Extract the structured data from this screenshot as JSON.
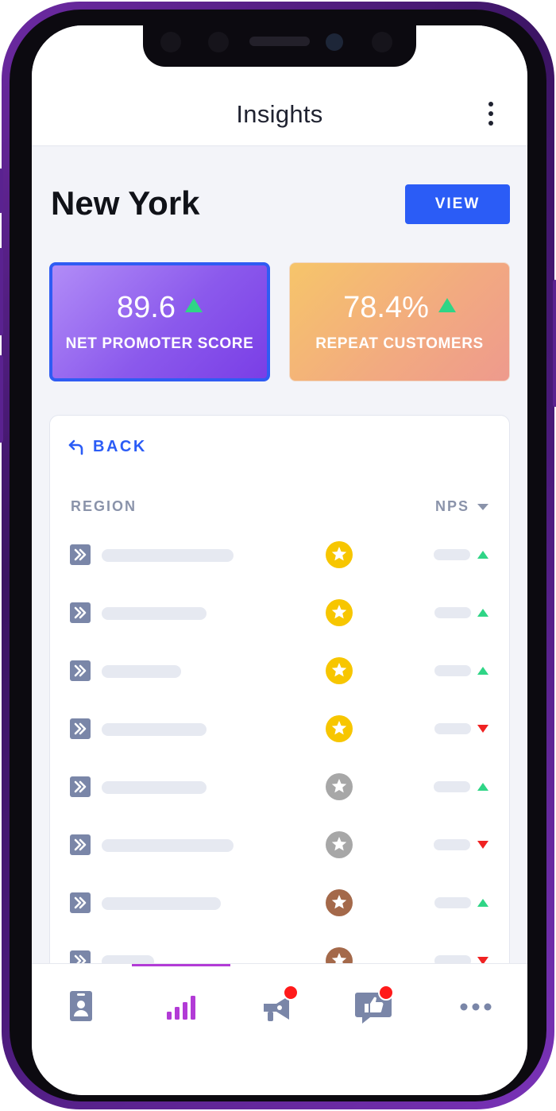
{
  "header": {
    "title": "Insights"
  },
  "location": {
    "name": "New York",
    "view_label": "VIEW"
  },
  "stats": {
    "nps": {
      "value": "89.6",
      "label": "NET PROMOTER SCORE",
      "trend": "up"
    },
    "repeat": {
      "value": "78.4%",
      "label": "REPEAT CUSTOMERS",
      "trend": "up"
    }
  },
  "panel": {
    "back_label": "BACK",
    "columns": {
      "region": "REGION",
      "nps": "NPS"
    },
    "rows": [
      {
        "medal": "gold",
        "trend": "up"
      },
      {
        "medal": "gold",
        "trend": "up"
      },
      {
        "medal": "gold",
        "trend": "up"
      },
      {
        "medal": "gold",
        "trend": "down"
      },
      {
        "medal": "silver",
        "trend": "up"
      },
      {
        "medal": "silver",
        "trend": "down"
      },
      {
        "medal": "bronze",
        "trend": "up"
      },
      {
        "medal": "bronze",
        "trend": "down"
      }
    ]
  },
  "tabbar": {
    "items": [
      {
        "icon": "badge-icon",
        "active": false,
        "notification": false
      },
      {
        "icon": "bar-chart-icon",
        "active": true,
        "notification": false
      },
      {
        "icon": "megaphone-icon",
        "active": false,
        "notification": true
      },
      {
        "icon": "thumbs-up-icon",
        "active": false,
        "notification": true
      },
      {
        "icon": "more-icon",
        "active": false,
        "notification": false
      }
    ]
  },
  "colors": {
    "accent": "#2b5cf6",
    "active_tab": "#b23bd6",
    "trend_up": "#2fd586",
    "trend_down": "#f02222",
    "gold": "#f7c600",
    "silver": "#a7a7a7",
    "bronze": "#a4694a"
  }
}
